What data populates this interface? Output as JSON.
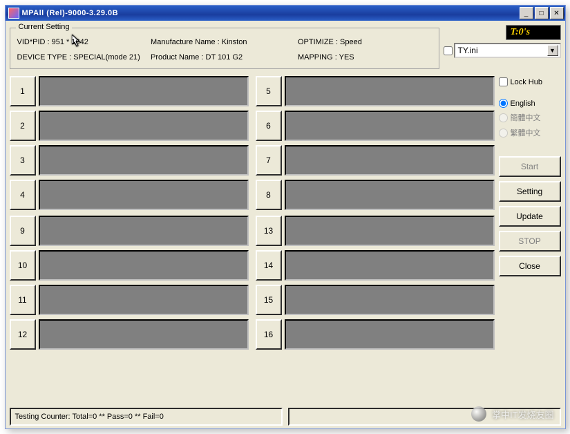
{
  "window": {
    "title": "MPAll (Rel)-9000-3.29.0B"
  },
  "timer": "T:0's",
  "current_setting": {
    "legend": "Current Setting",
    "vid_pid": "VID*PID :  951 * 1642",
    "manufacture": "Manufacture Name : Kinston",
    "optimize": "OPTIMIZE : Speed",
    "device_type": "DEVICE TYPE : SPECIAL(mode 21)",
    "product": "Product Name : DT 101 G2",
    "mapping": "MAPPING : YES"
  },
  "ini": {
    "value": "TY.ini"
  },
  "lock_hub": "Lock Hub",
  "lang": {
    "english": "English",
    "simp": "簡體中文",
    "trad": "繁體中文"
  },
  "buttons": {
    "start": "Start",
    "setting": "Setting",
    "update": "Update",
    "stop": "STOP",
    "close": "Close"
  },
  "slots_left_a": [
    "1",
    "2",
    "3",
    "4"
  ],
  "slots_right_a": [
    "5",
    "6",
    "7",
    "8"
  ],
  "slots_left_b": [
    "9",
    "10",
    "11",
    "12"
  ],
  "slots_right_b": [
    "13",
    "14",
    "15",
    "16"
  ],
  "status": "Testing Counter: Total=0 ** Pass=0 ** Fail=0",
  "watermark": "掌中IT发烧友圈"
}
